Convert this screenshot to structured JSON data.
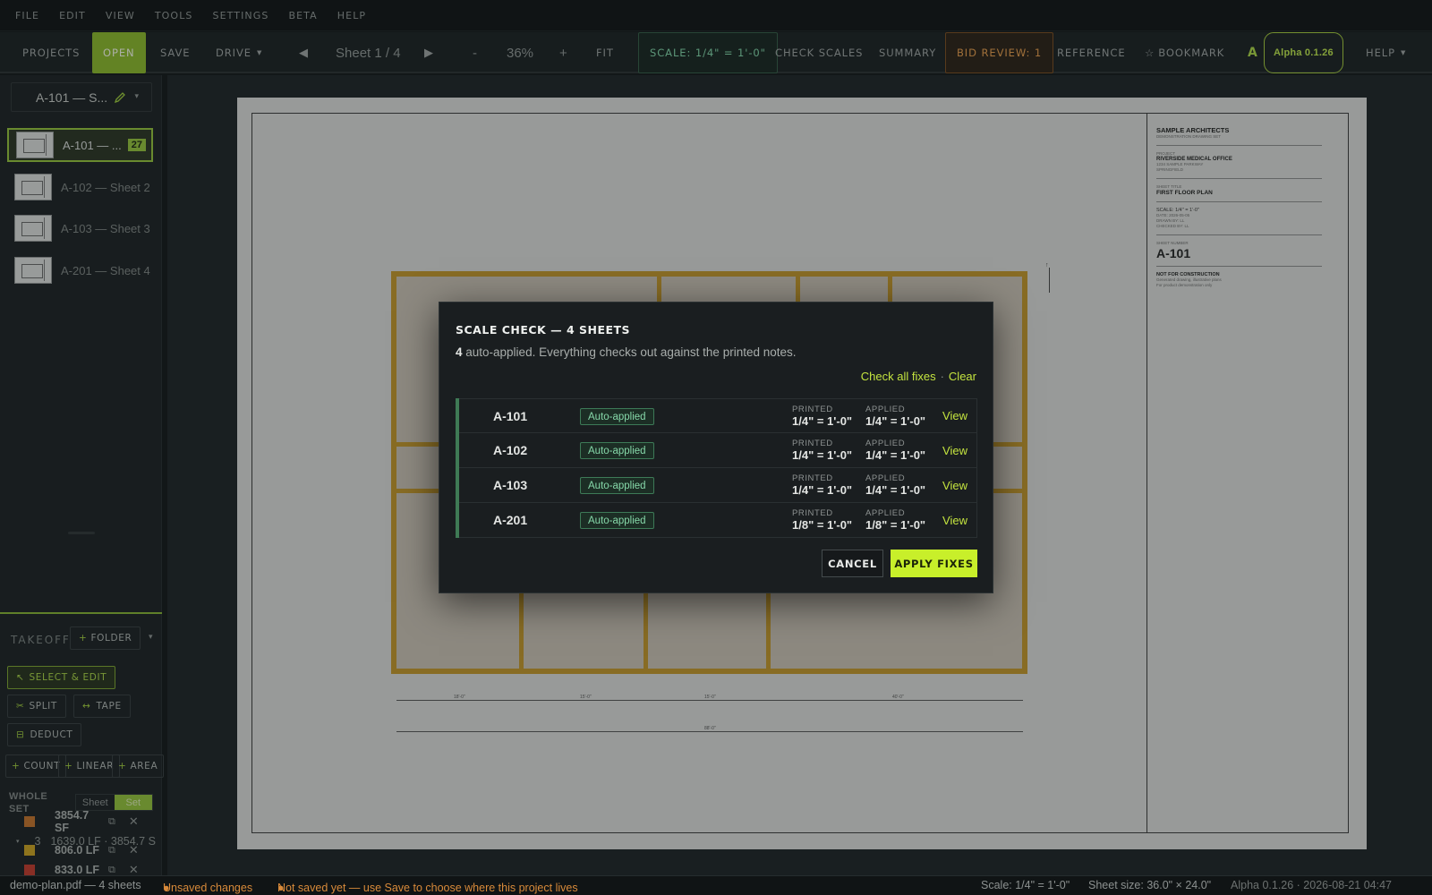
{
  "menu": [
    "FILE",
    "EDIT",
    "VIEW",
    "TOOLS",
    "SETTINGS",
    "BETA",
    "HELP"
  ],
  "toolbar": {
    "projects": "PROJECTS",
    "open": "OPEN",
    "save": "SAVE",
    "drive": "DRIVE",
    "sheet_indicator": "Sheet 1 / 4",
    "zoom_minus": "-",
    "zoom": "36%",
    "zoom_plus": "+",
    "fit": "FIT",
    "scale": "SCALE: 1/4\" = 1'-0\"",
    "check_scales": "CHECK SCALES",
    "summary": "SUMMARY",
    "bid_review": "BID REVIEW: 1",
    "reference": "REFERENCE",
    "bookmark": "BOOKMARK",
    "version": "Alpha 0.1.26",
    "help": "HELP"
  },
  "sidebar": {
    "doc_title": "A-101 — S...",
    "sheets": [
      {
        "label": "A-101 — ...",
        "count": "27",
        "selected": true
      },
      {
        "label": "A-102 — Sheet 2"
      },
      {
        "label": "A-103 — Sheet 3"
      },
      {
        "label": "A-201 — Sheet 4"
      }
    ]
  },
  "takeoff": {
    "heading": "TAKEOFF",
    "folder": "FOLDER",
    "select_edit": "SELECT & EDIT",
    "split": "SPLIT",
    "tape": "TAPE",
    "deduct": "DEDUCT",
    "count": "COUNT",
    "linear": "LINEAR",
    "area": "AREA",
    "whole_set": "WHOLE SET",
    "sheet": "Sheet",
    "set": "Set",
    "group_count": "3",
    "group_summary": "1639.0 LF · 3854.7 S",
    "items": [
      {
        "value": "833.0 LF",
        "color": "#c0392b"
      },
      {
        "value": "3854.7 SF",
        "color": "#c2702a"
      },
      {
        "value": "806.0 LF",
        "color": "#c9a020"
      }
    ]
  },
  "titleblock": {
    "firm": "SAMPLE ARCHITECTS",
    "firm_sub": "DEMONSTRATION DRAWING SET",
    "project_lbl": "PROJECT",
    "project": "RIVERSIDE MEDICAL OFFICE",
    "address1": "1234 SAMPLE PARKWAY",
    "address2": "SPRINGFIELD",
    "sheet_title_lbl": "SHEET TITLE",
    "sheet_title": "FIRST FLOOR PLAN",
    "scale": "SCALE:   1/4\" = 1'-0\"",
    "date": "DATE:    2026-05-05",
    "drawn": "DRAWN BY:    LL",
    "checked": "CHECKED BY:    LL",
    "sheet_no_lbl": "SHEET NUMBER",
    "sheet_no": "A-101",
    "nfc": "NOT FOR CONSTRUCTION",
    "nfc1": "Generated drawing, illustrative plans",
    "nfc2": "For product demonstration only"
  },
  "dims": {
    "d1": "18'-0\"",
    "d2": "15'-0\"",
    "d3": "15'-0\"",
    "d4": "40'-0\"",
    "total": "88'-0\""
  },
  "modal": {
    "title": "SCALE CHECK — 4 SHEETS",
    "sub_count": "4",
    "sub_text": " auto-applied. Everything checks out against the printed notes.",
    "check_all": "Check all fixes",
    "clear": "Clear",
    "printed_label": "PRINTED",
    "applied_label": "APPLIED",
    "view_label": "View",
    "rows": [
      {
        "id": "A-101",
        "status": "Auto-applied",
        "printed": "1/4\" = 1'-0\"",
        "applied": "1/4\" = 1'-0\""
      },
      {
        "id": "A-102",
        "status": "Auto-applied",
        "printed": "1/4\" = 1'-0\"",
        "applied": "1/4\" = 1'-0\""
      },
      {
        "id": "A-103",
        "status": "Auto-applied",
        "printed": "1/4\" = 1'-0\"",
        "applied": "1/4\" = 1'-0\""
      },
      {
        "id": "A-201",
        "status": "Auto-applied",
        "printed": "1/8\" = 1'-0\"",
        "applied": "1/8\" = 1'-0\""
      }
    ],
    "cancel": "CANCEL",
    "apply": "APPLY FIXES"
  },
  "status": {
    "file": "demo-plan.pdf — 4 sheets",
    "unsaved": "Unsaved changes",
    "not_saved": "Not saved yet — use Save to choose where this project lives",
    "scale": "Scale: 1/4\" = 1'-0\"",
    "sheet_size": "Sheet size: 36.0\" × 24.0\"",
    "version_date": "Alpha 0.1.26 · 2026-08-21 04:47"
  }
}
